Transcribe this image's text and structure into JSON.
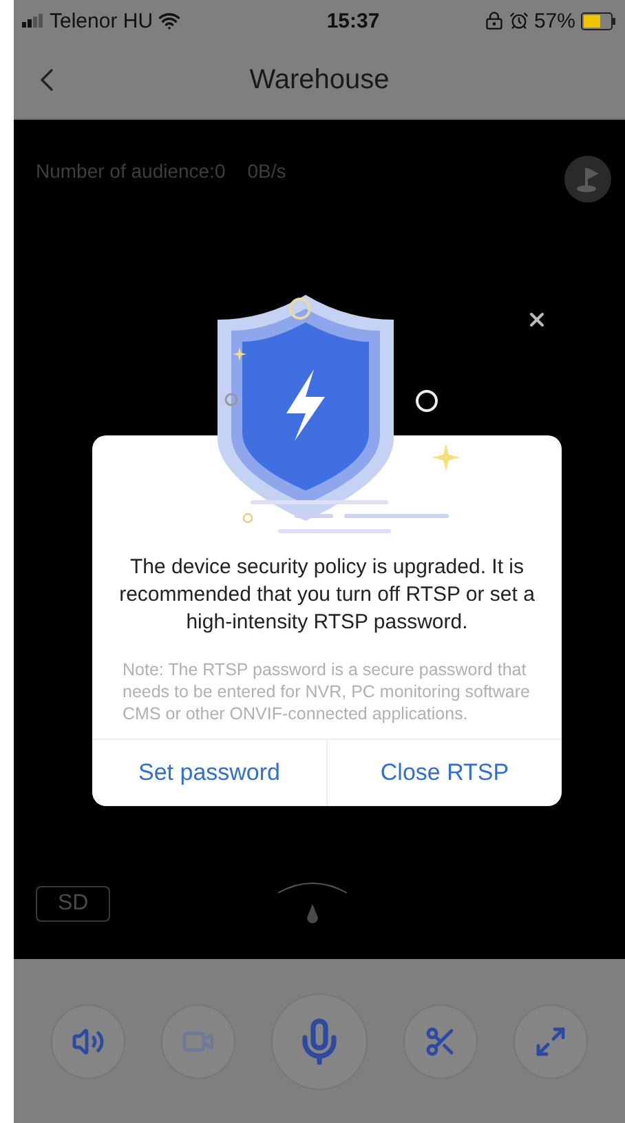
{
  "status_bar": {
    "carrier": "Telenor HU",
    "time": "15:37",
    "battery": "57%"
  },
  "nav": {
    "title": "Warehouse"
  },
  "video": {
    "info": "Number of audience:0",
    "rate": "0B/s",
    "quality": "SD"
  },
  "dialog": {
    "message": "The device security policy is upgraded. It is recommended that you turn off RTSP or set a high-intensity RTSP password.",
    "note": "Note: The RTSP password is a secure password that needs to be entered for NVR, PC monitoring software CMS or other ONVIF-connected applications.",
    "buttons": [
      "Set password",
      "Close RTSP"
    ]
  },
  "controls": [
    {
      "kind": "sound",
      "disabled": false
    },
    {
      "kind": "record",
      "disabled": true
    },
    {
      "kind": "mic",
      "disabled": false
    },
    {
      "kind": "cut",
      "disabled": false
    },
    {
      "kind": "fullscreen",
      "disabled": false
    }
  ]
}
